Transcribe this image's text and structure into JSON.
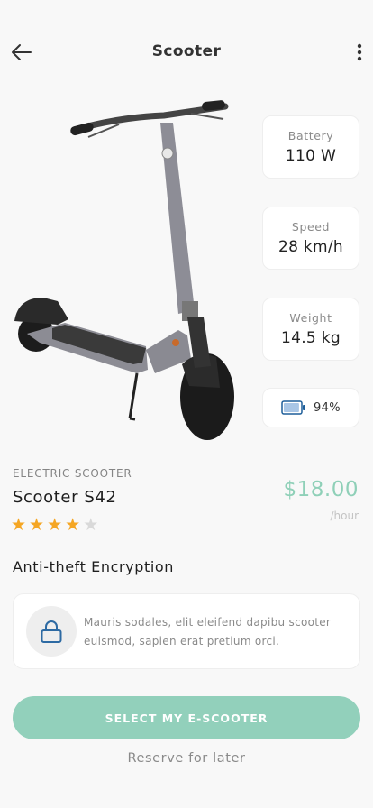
{
  "header": {
    "title": "Scooter"
  },
  "specs": {
    "battery": {
      "label": "Battery",
      "value": "110 W"
    },
    "speed": {
      "label": "Speed",
      "value": "28 km/h"
    },
    "weight": {
      "label": "Weight",
      "value": "14.5 kg"
    },
    "charge": {
      "value": "94%",
      "level": 0.94
    }
  },
  "product": {
    "category": "ELECTRIC SCOOTER",
    "name": "Scooter S42",
    "rating": 4,
    "rating_max": 5,
    "price": "$18.00",
    "price_unit": "/hour"
  },
  "feature": {
    "title": "Anti-theft Encryption",
    "description": "Mauris sodales, elit eleifend dapibu scooter euismod, sapien erat pretium orci.",
    "icon": "lock-icon"
  },
  "actions": {
    "primary_label": "SELECT MY E-SCOOTER",
    "secondary_label": "Reserve for later"
  },
  "colors": {
    "accent": "#92d0bb",
    "price": "#8fd0b8",
    "star_active": "#f5a623",
    "star_inactive": "#d9d9d9",
    "battery_icon": "#1f5f9a"
  }
}
